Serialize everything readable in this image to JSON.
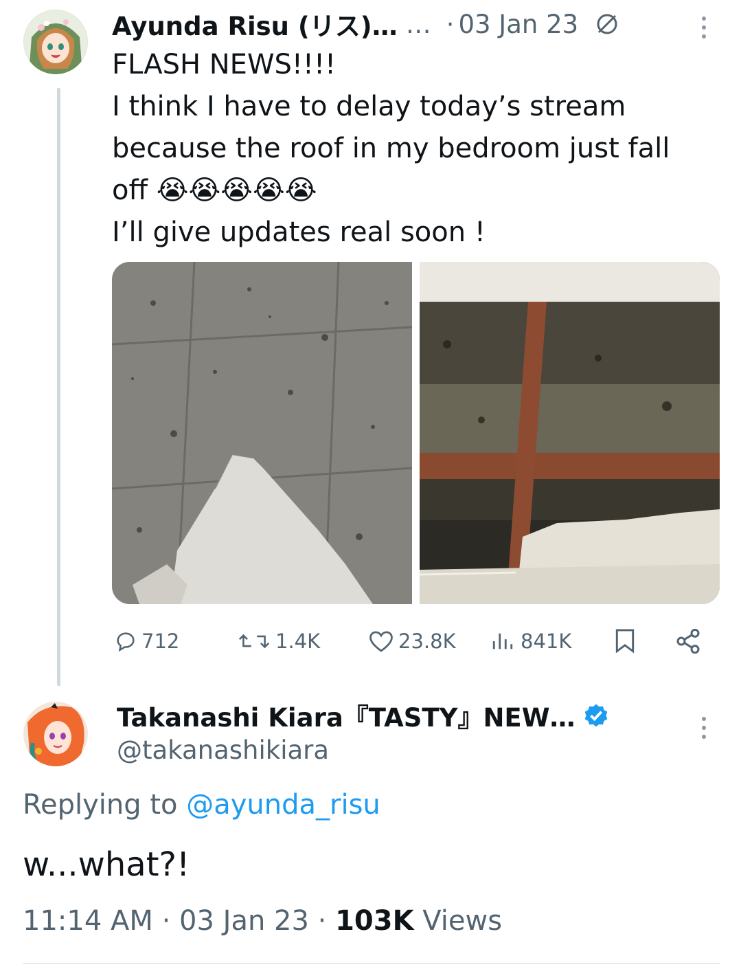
{
  "tweet": {
    "author_name": "Ayunda Risu (リス)…",
    "handle_truncated": "…",
    "separator": "·",
    "date": "03 Jan 23",
    "lines": [
      "FLASH NEWS!!!!",
      "I think I have to delay today’s stream",
      "because the roof in my bedroom just fall",
      "off 😭😭😭😭😭",
      "I’ll give updates real soon !"
    ],
    "media": [
      "floor-debris-photo",
      "ceiling-hole-photo"
    ],
    "actions": {
      "replies": "712",
      "retweets": "1.4K",
      "likes": "23.8K",
      "views": "841K"
    }
  },
  "reply": {
    "author_name": "Takanashi Kiara『TASTY』NEW…",
    "handle": "@takanashikiara",
    "verified": true,
    "replying_prefix": "Replying to ",
    "replying_handle": "@ayunda_risu",
    "text": "w...what?!",
    "time": "11:14 AM",
    "separator": "·",
    "date": "03 Jan 23",
    "views_count": "103K",
    "views_label": "Views"
  },
  "colors": {
    "link": "#1d9bf0",
    "muted": "#536471",
    "verified": "#1d9bf0",
    "divider": "#cfd9de"
  },
  "icons": [
    "reply-icon",
    "retweet-icon",
    "heart-icon",
    "views-icon",
    "bookmark-icon",
    "share-icon",
    "more-icon",
    "verified-badge-icon",
    "slash-circle-icon"
  ]
}
